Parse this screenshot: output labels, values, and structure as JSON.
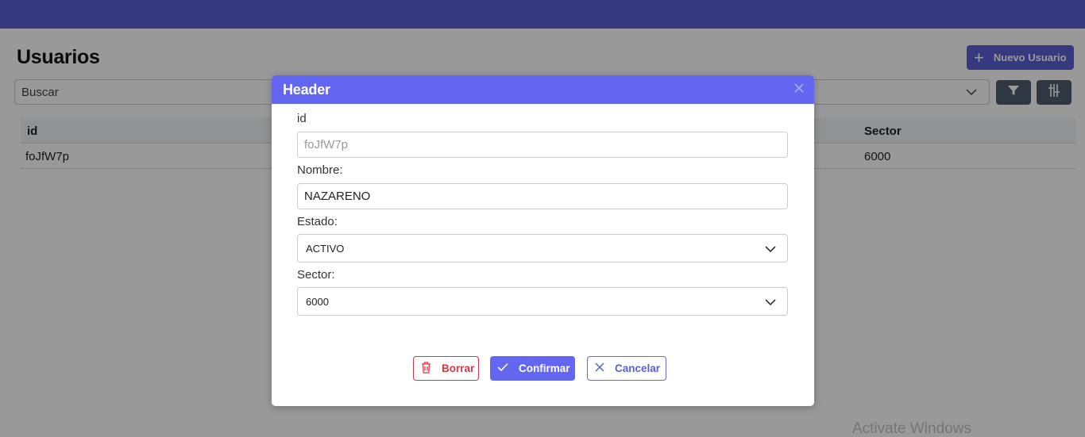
{
  "page": {
    "title": "Usuarios",
    "new_user_label": "Nuevo Usuario",
    "search_value": "Buscar"
  },
  "table": {
    "columns": [
      "id",
      "Sector"
    ],
    "rows": [
      {
        "id": "foJfW7p",
        "sector": "6000"
      }
    ]
  },
  "modal": {
    "title": "Header",
    "id_label": "id",
    "id_value": "foJfW7p",
    "nombre_label": "Nombre:",
    "nombre_value": "NAZARENO",
    "estado_label": "Estado:",
    "estado_value": "ACTIVO",
    "sector_label": "Sector:",
    "sector_value": "6000",
    "delete_label": "Borrar",
    "confirm_label": "Confirmar",
    "cancel_label": "Cancelar"
  },
  "watermark": "Activate Windows",
  "colors": {
    "accent": "#6366f1",
    "topbar": "#5a5fd6",
    "danger": "#dc3545",
    "icon_button": "#4d5c6e"
  },
  "icons": [
    "plus-icon",
    "chevron-down-icon",
    "filter-icon",
    "columns-icon",
    "close-icon",
    "trash-icon",
    "check-icon",
    "x-icon"
  ]
}
